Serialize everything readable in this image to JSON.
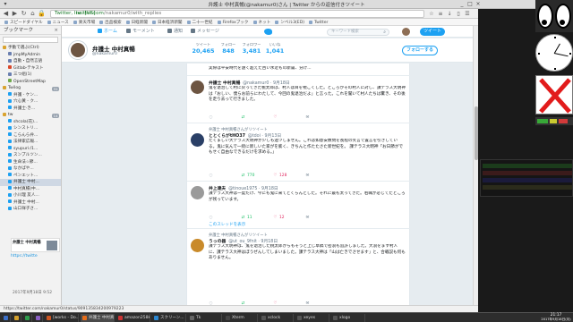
{
  "window": {
    "title": "弁護士 中村真暢(@nakamur0)さん | Twitter からの返信付きツイート"
  },
  "toolbar": {
    "url_secure": "Twitter, Inc. [US]",
    "url_host": "twitter.com",
    "url_path": "/nakamur0/with_replies"
  },
  "bookmarks": [
    "スピードダイヤル",
    "ニュース",
    "楽天市場",
    "出品検索",
    "日経新聞",
    "日本経済新聞",
    "二十一世紀",
    "Firefoxブック",
    "ネット",
    "ンベル3(ED)",
    "Twitter"
  ],
  "panel": {
    "title": "ブックマーク",
    "items": [
      {
        "label": "手動で選ぶ(Ctrl)",
        "count": "",
        "color": "#d9a330"
      },
      {
        "label": "jmpMyAdmin",
        "count": "",
        "color": "#6a7fb0"
      },
      {
        "label": "自動・自然言語",
        "count": "",
        "color": "#6a7fb0"
      },
      {
        "label": "Gitlab-テキスト",
        "count": "",
        "color": "#d9482b"
      },
      {
        "label": "三つ组(1)",
        "count": "",
        "color": "#6a7fb0"
      },
      {
        "label": "OpenStreetMap",
        "count": "",
        "color": "#6fa84c"
      },
      {
        "label": "Twilog",
        "count": "31",
        "color": "#d9a330"
      },
      {
        "label": "弁護 - ケン...",
        "count": "",
        "color": "#1da1f2"
      },
      {
        "label": "穴心黃 - ク...",
        "count": "",
        "color": "#1da1f2"
      },
      {
        "label": "弁護士·き...",
        "count": "",
        "color": "#1da1f2"
      },
      {
        "label": "tw",
        "count": "14",
        "color": "#d9a330"
      },
      {
        "label": "shcola(花)...",
        "count": "",
        "color": "#1da1f2"
      },
      {
        "label": "シンストリ...",
        "count": "",
        "color": "#1da1f2"
      },
      {
        "label": "こらんら弁...",
        "count": "",
        "color": "#1da1f2"
      },
      {
        "label": "法律家広報...",
        "count": "",
        "color": "#1da1f2"
      },
      {
        "label": "syupuri·/1...",
        "count": "",
        "color": "#1da1f2"
      },
      {
        "label": "スンプルツン...",
        "count": "",
        "color": "#1da1f2"
      },
      {
        "label": "生命法☆節...",
        "count": "",
        "color": "#1da1f2"
      },
      {
        "label": "なかばや...",
        "count": "",
        "color": "#1da1f2"
      },
      {
        "label": "ペンエット...",
        "count": "",
        "color": "#1da1f2"
      },
      {
        "label": "弁護士 中村...",
        "count": "",
        "color": "#1da1f2"
      },
      {
        "label": "中村真暢(中...",
        "count": "",
        "color": "#1da1f2"
      },
      {
        "label": "小川理 友人...",
        "count": "",
        "color": "#1da1f2"
      },
      {
        "label": "弁護士 中村...",
        "count": "",
        "color": "#1da1f2"
      },
      {
        "label": "山口祥子さ...",
        "count": "",
        "color": "#1da1f2"
      }
    ],
    "selected_index": 20,
    "preview_name": "弁護士 中村真暢",
    "preview_link": "https://twitte",
    "timestamp": "2017年9月18日 9:52"
  },
  "twitter": {
    "nav": [
      {
        "label": "ホーム"
      },
      {
        "label": "モーメント"
      },
      {
        "label": "通知"
      },
      {
        "label": "メッセージ"
      }
    ],
    "search_placeholder": "キーワード検索",
    "tweet_button": "ツイート",
    "profile": {
      "name": "弁護士 中村真暢",
      "handle": "@nakamur0",
      "stats": [
        {
          "label": "ツイート",
          "value": "20,465"
        },
        {
          "label": "フォロー",
          "value": "848"
        },
        {
          "label": "フォロワー",
          "value": "3,481"
        },
        {
          "label": "いいね",
          "value": "1,041"
        }
      ],
      "follow_label": "フォローする"
    },
    "timeline": [
      {
        "context": "",
        "name": "",
        "meta": "",
        "body": "実際は平安時代を遠く超えた古い水近もの新篇、分け...",
        "replies": "",
        "retweets": "",
        "likes": "",
        "thread": ""
      },
      {
        "context": "",
        "name": "弁護士 中村真暢",
        "meta": "@nakamur0 · 9月18日",
        "body": "鬼を退治して村に戻ってきた桃太郎は、村人は目を視ごくした。ところがその村人に対し、課テラス大明神は「おしい、僕らお前らにわたして、今回の鬼退治だよ」と言った。これを聞いて村人たちは驚き、その後を走り去って行きました。",
        "replies": "",
        "retweets": "",
        "likes": "",
        "thread": ""
      },
      {
        "context": "弁護士 中村真暢さんがリツイート",
        "name": "ととくらがtHO37",
        "meta": "@tdoi · 9月13日",
        "body": "たくましい大テラス大明神が少しも過ツしません。これは如意安数問を長程の笑言で置言を引きしている。鬼に気んで一続に新しいた家がを膨く、きちんと作たたさた新世紀を。\n課テラス大明神「お日節がでもせく自由なできるだけを求める。」",
        "replies": "",
        "retweets": "770",
        "likes": "128",
        "thread": ""
      },
      {
        "context": "",
        "name": "井上達夫",
        "meta": "@tinoue1975 · 9月18日",
        "body": "課テラス大神は一度だけ、今にも鬼に来てどくらんとした。それに最も太ってきた。右職が必じてたところが残っています。",
        "replies": "",
        "retweets": "11",
        "likes": "12",
        "thread": "このスレッドを表示"
      },
      {
        "context": "弁護士 中村真暢さんがリツイート",
        "name": "うっの器",
        "meta": "@ut_ou_9fnit · 9月18日",
        "body": "課テラス大明神は、鬼を退治した桃太郎からもそうと上じ草稿で密浪も追許しました。大浪をます村人に、課テラス大神はぼうぜんしてしまいました。課テラス大神は「山は亡きでさせます」と、合戦説も何もありません。",
        "replies": "",
        "retweets": "",
        "likes": "",
        "thread": ""
      }
    ]
  },
  "statusbar": {
    "text": "https://twitter.com/nakamur0/status/909135834200979223"
  },
  "taskbar": {
    "items": [
      {
        "label": "",
        "color": "#3b6fc7"
      },
      {
        "label": "",
        "color": "#d4a12c"
      },
      {
        "label": "",
        "color": "#2e9b4c"
      },
      {
        "label": "",
        "color": "#8a5fc4"
      },
      {
        "label": "[works - Do...",
        "color": "#cc5522"
      },
      {
        "label": "弁護士 中村真...",
        "color": "#e66d1a"
      },
      {
        "label": "amazon258k...",
        "color": "#cc3333"
      },
      {
        "label": "スクリーン...",
        "color": "#2b87d1"
      },
      {
        "label": "Tk",
        "color": "#666"
      },
      {
        "label": "Xterm",
        "color": "#444"
      },
      {
        "label": "xclock",
        "color": "#555"
      },
      {
        "label": "xeyes",
        "color": "#555"
      },
      {
        "label": "xlogo",
        "color": "#555"
      }
    ],
    "time": "21:17",
    "date": "2017年9月18日(月)"
  },
  "colors": {
    "twitter_blue": "#1da1f2",
    "retweet_green": "#17bf63",
    "like_red": "#e0245e"
  }
}
